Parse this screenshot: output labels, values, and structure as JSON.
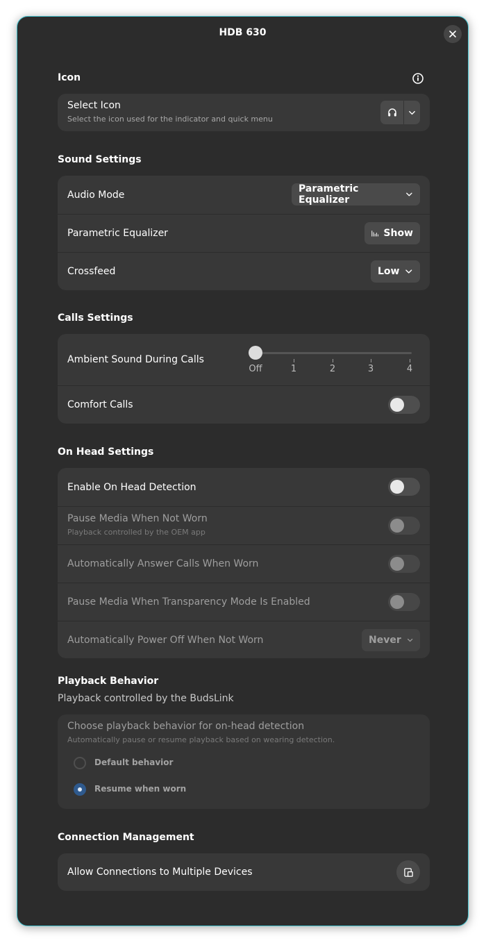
{
  "window": {
    "title": "HDB 630"
  },
  "icon_section": {
    "title": "Icon",
    "select_icon": {
      "label": "Select Icon",
      "subtitle": "Select the icon used for the indicator and quick menu",
      "current_icon": "headphones-icon"
    }
  },
  "sound_section": {
    "title": "Sound Settings",
    "audio_mode": {
      "label": "Audio Mode",
      "value": "Parametric Equalizer"
    },
    "parametric_equalizer": {
      "label": "Parametric Equalizer",
      "button": "Show"
    },
    "crossfeed": {
      "label": "Crossfeed",
      "value": "Low"
    }
  },
  "calls_section": {
    "title": "Calls Settings",
    "ambient": {
      "label": "Ambient Sound During Calls",
      "ticks": [
        "Off",
        "1",
        "2",
        "3",
        "4"
      ],
      "value_index": 0
    },
    "comfort_calls": {
      "label": "Comfort Calls",
      "on": false
    }
  },
  "on_head_section": {
    "title": "On Head Settings",
    "enable": {
      "label": "Enable On Head Detection",
      "on": false
    },
    "pause_not_worn": {
      "label": "Pause Media When Not Worn",
      "subtitle": "Playback controlled by the OEM app",
      "on": false
    },
    "auto_answer": {
      "label": "Automatically Answer Calls When Worn",
      "on": false
    },
    "pause_transparency": {
      "label": "Pause Media When Transparency Mode Is Enabled",
      "on": false
    },
    "auto_power_off": {
      "label": "Automatically Power Off When Not Worn",
      "value": "Never"
    }
  },
  "playback_section": {
    "title": "Playback Behavior",
    "subtitle": "Playback controlled by the BudsLink",
    "choose": {
      "label": "Choose playback behavior for on-head detection",
      "subtitle": "Automatically pause or resume playback based on wearing detection.",
      "options": [
        "Default behavior",
        "Resume when worn"
      ],
      "selected_index": 1
    }
  },
  "connection_section": {
    "title": "Connection Management",
    "multi": {
      "label": "Allow Connections to Multiple Devices"
    }
  },
  "colors": {
    "accent": "#2f5a8e",
    "window_border": "#46c3cf",
    "background": "#2c2c2c",
    "card": "#383838"
  }
}
